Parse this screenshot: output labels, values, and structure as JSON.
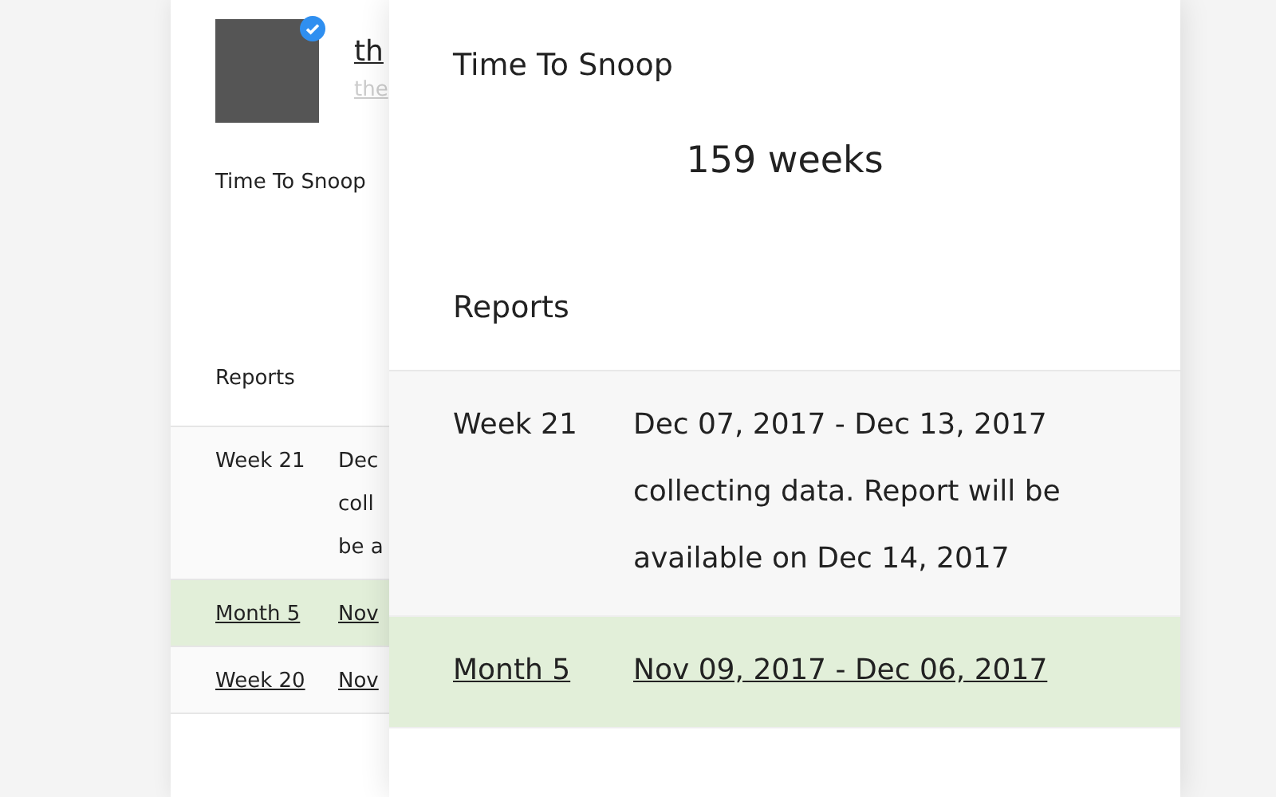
{
  "back_card": {
    "profile": {
      "name": "th",
      "handle": "the",
      "verified": true
    },
    "title": "Time To Snoop",
    "reports_heading": "Reports",
    "rows": [
      {
        "period": "Week 21",
        "details": [
          "Dec",
          "coll",
          "be a"
        ],
        "link": false,
        "selected": false
      },
      {
        "period": "Month 5",
        "details": [
          "Nov"
        ],
        "link": true,
        "selected": true
      },
      {
        "period": "Week 20",
        "details": [
          "Nov"
        ],
        "link": true,
        "selected": false
      }
    ]
  },
  "front_card": {
    "title": "Time To Snoop",
    "value": "159 weeks",
    "reports_heading": "Reports",
    "rows": [
      {
        "period": "Week 21",
        "details": "Dec 07, 2017 - Dec 13, 2017 collecting data. Report will be available on Dec 14, 2017",
        "link": false,
        "selected": false
      },
      {
        "period": "Month 5",
        "details": "Nov 09, 2017 - Dec 06, 2017",
        "link": true,
        "selected": true
      }
    ]
  }
}
